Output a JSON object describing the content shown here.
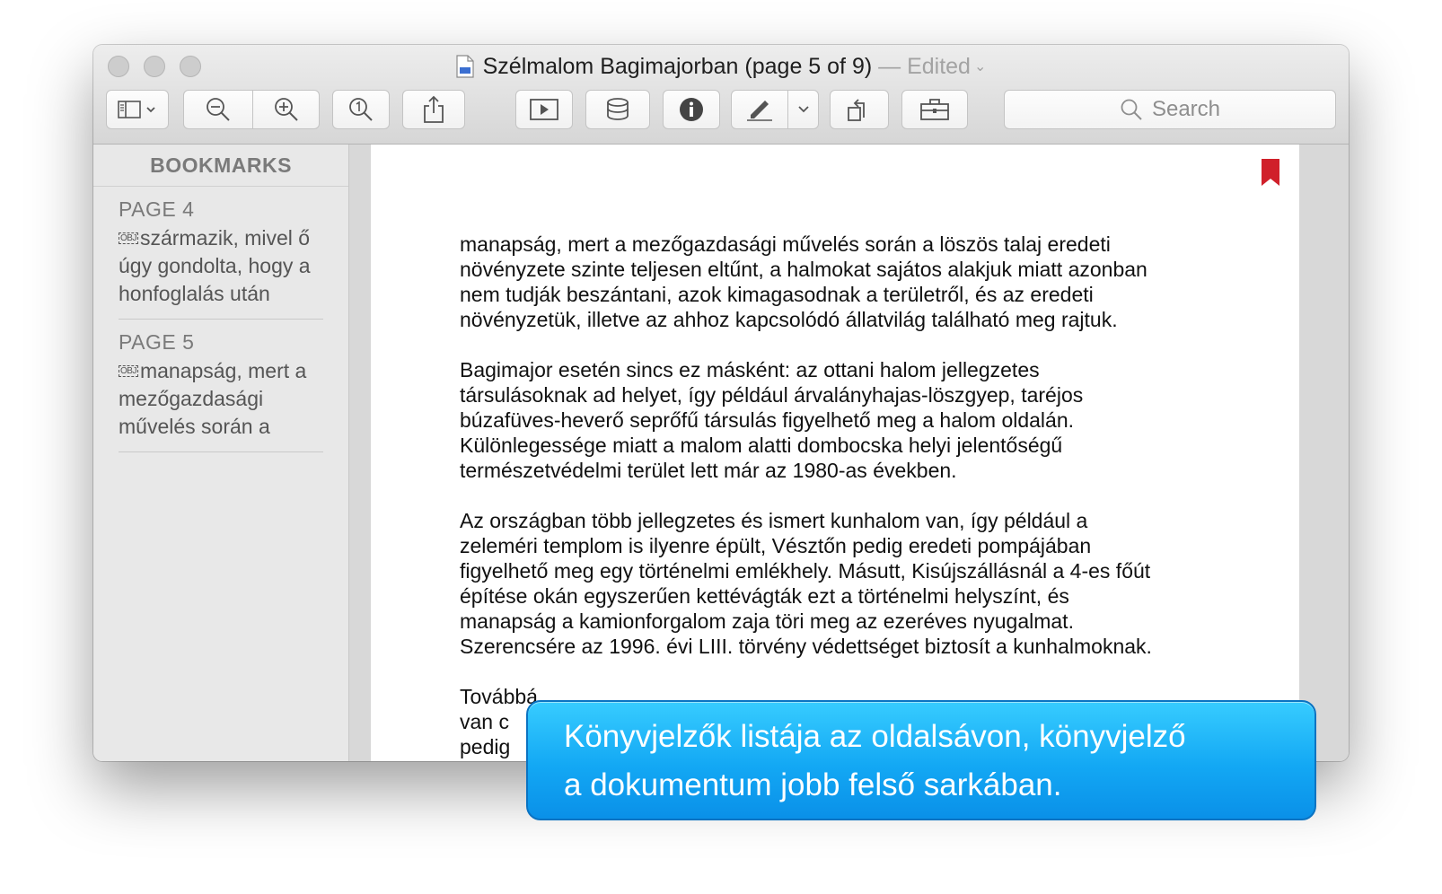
{
  "window": {
    "title": "Szélmalom Bagimajorban (page 5 of 9)",
    "title_separator": " — ",
    "edited_label": "Edited"
  },
  "toolbar": {
    "icons": [
      "sidebar-icon",
      "zoom-out-icon",
      "zoom-in-icon",
      "actual-size-icon",
      "share-icon",
      "slideshow-icon",
      "database-icon",
      "info-icon",
      "markup-pen-icon",
      "rotate-icon",
      "toolbox-icon"
    ],
    "search_placeholder": "Search"
  },
  "sidebar": {
    "header": "BOOKMARKS",
    "items": [
      {
        "page": "PAGE 4",
        "obj": "OBJ",
        "lines": [
          "származik, mivel ő",
          "úgy gondolta, hogy a",
          "honfoglalás után"
        ]
      },
      {
        "page": "PAGE 5",
        "obj": "OBJ",
        "lines": [
          "manapság, mert a",
          "mezőgazdasági",
          "művelés során a"
        ]
      }
    ]
  },
  "document": {
    "paragraphs": [
      "manapság, mert a mezőgazdasági művelés során a löszös talaj eredeti\nnövényzete szinte teljesen eltűnt, a halmokat sajátos alakjuk miatt azonban\nnem tudják beszántani, azok kimagasodnak a területről, és az eredeti\nnövényzetük, illetve az ahhoz kapcsolódó állatvilág található meg rajtuk.",
      "Bagimajor esetén sincs ez másként: az ottani halom jellegzetes\ntársulásoknak ad helyet, így például árvalányhajas-löszgyep, taréjos\nbúzafüves-heverő seprőfű társulás figyelhető meg a halom oldalán.\nKülönlegessége miatt a malom alatti dombocska helyi jelentőségű\ntermészetvédelmi terület lett már az 1980-as években.",
      "Az országban több jellegzetes és ismert kunhalom van, így például a\nzeleméri templom is ilyenre épült, Vésztőn pedig eredeti pompájában\nfigyelhető meg egy történelmi emlékhely. Másutt, Kisújszállásnál a 4-es főút\népítése okán egyszerűen kettévágták ezt a történelmi helyszínt, és\nmanapság a kamionforgalom zaja töri meg az ezeréves nyugalmat.\nSzerencsére az 1996. évi LIII. törvény védettséget biztosít a kunhalmoknak.",
      "Továbbá\nvan c\npedig"
    ],
    "bookmark_color": "#d0202a"
  },
  "callout": {
    "line1": "Könyvjelzők listája az oldalsávon, könyvjelző",
    "line2": "a dokumentum jobb felső sarkában."
  }
}
